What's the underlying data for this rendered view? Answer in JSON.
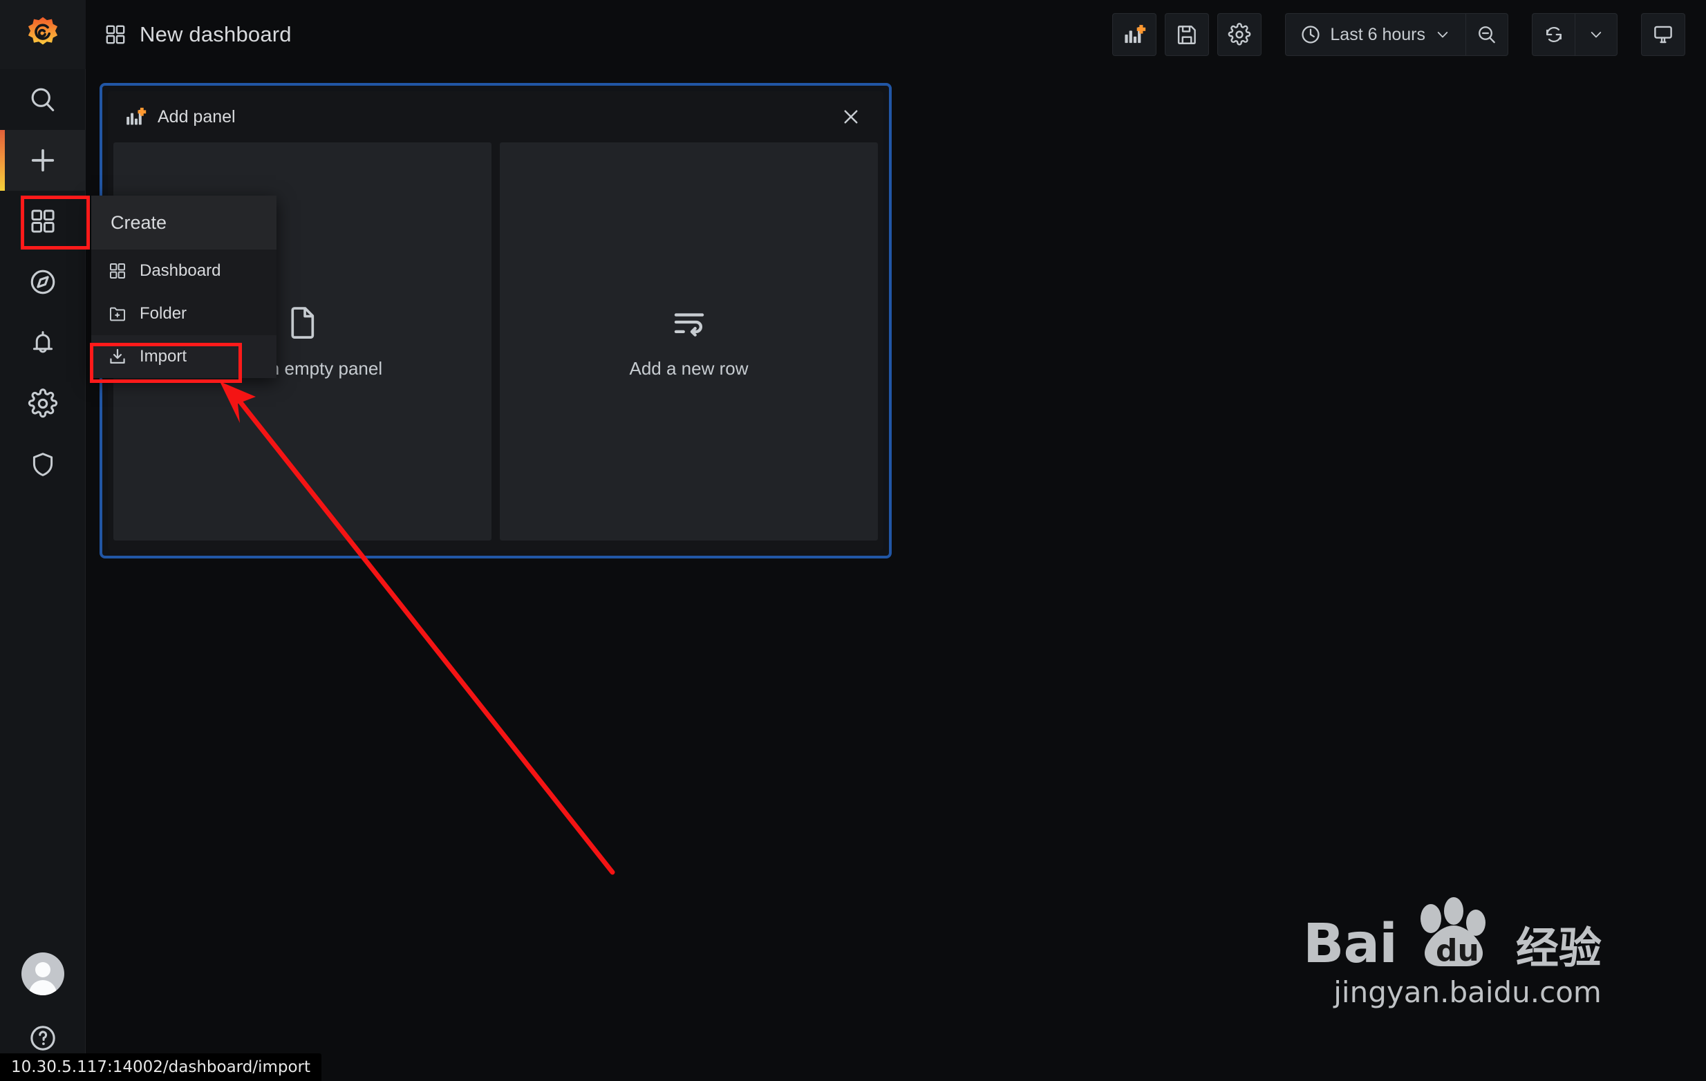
{
  "app": {
    "brand_icon": "grafana-logo-icon",
    "page_title": "New dashboard",
    "page_title_icon": "dashboard-grid-icon"
  },
  "sidebar": {
    "items": [
      {
        "name": "search",
        "icon": "search-icon",
        "active": false
      },
      {
        "name": "create",
        "icon": "plus-icon",
        "active": true
      },
      {
        "name": "dashboards",
        "icon": "dashboard-grid-icon",
        "active": false
      },
      {
        "name": "explore",
        "icon": "compass-icon",
        "active": false
      },
      {
        "name": "alerting",
        "icon": "bell-icon",
        "active": false
      },
      {
        "name": "configuration",
        "icon": "gear-icon",
        "active": false
      },
      {
        "name": "server-admin",
        "icon": "shield-icon",
        "active": false
      }
    ],
    "bottom": [
      {
        "name": "profile",
        "icon": "user-avatar-icon"
      },
      {
        "name": "help",
        "icon": "question-circle-icon"
      }
    ]
  },
  "toolbar": {
    "add_panel_icon": "bar-chart-plus-icon",
    "save_icon": "floppy-disk-icon",
    "settings_icon": "gear-icon",
    "time_picker": {
      "icon": "clock-icon",
      "label": "Last 6 hours",
      "chevron": "chevron-down-icon"
    },
    "zoom_out_icon": "magnifier-minus-icon",
    "refresh_icon": "refresh-circular-icon",
    "refresh_chevron": "chevron-down-icon",
    "kiosk_icon": "monitor-icon"
  },
  "add_panel": {
    "title": "Add panel",
    "title_icon": "bar-chart-plus-icon",
    "close_icon": "close-x-icon",
    "cards": [
      {
        "label": "Add an empty panel",
        "icon": "file-blank-icon"
      },
      {
        "label": "Add a new row",
        "icon": "wrap-text-row-icon"
      }
    ],
    "border_color": "#2156a5"
  },
  "create_menu": {
    "header": "Create",
    "items": [
      {
        "label": "Dashboard",
        "icon": "dashboard-grid-icon",
        "selected": false
      },
      {
        "label": "Folder",
        "icon": "folder-plus-icon",
        "selected": false
      },
      {
        "label": "Import",
        "icon": "import-download-icon",
        "selected": true
      }
    ]
  },
  "annotations": {
    "highlight_color": "#ff1a1a",
    "arrow_color": "#f41414",
    "boxes": [
      "sidebar-plus-item",
      "create-menu-import-item"
    ],
    "arrow_from": "import-menu-item",
    "arrow_to": "lower-right-empty-area"
  },
  "watermark": {
    "brand_latin": "Bai",
    "brand_du": "du",
    "brand_cn": "经验",
    "url": "jingyan.baidu.com"
  },
  "status_bar": {
    "url": "10.30.5.117:14002/dashboard/import"
  }
}
